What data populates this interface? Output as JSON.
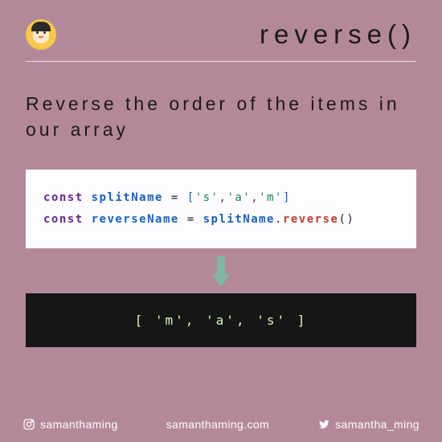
{
  "header": {
    "title": "reverse()"
  },
  "description": "Reverse the order of the items in our array",
  "code": {
    "kw1": "const",
    "var1": "splitName",
    "eq": "=",
    "open": "[",
    "s": "'s'",
    "c1": ",",
    "a": "'a'",
    "c2": ",",
    "m": "'m'",
    "close": "]",
    "kw2": "const",
    "var2": "reverseName",
    "eq2": "=",
    "ref": "splitName",
    "dot": ".",
    "method": "reverse",
    "paren": "()"
  },
  "result": "[ 'm', 'a', 's' ]",
  "footer": {
    "instagram": "samanthaming",
    "site": "samanthaming.com",
    "twitter": "samantha_ming"
  }
}
